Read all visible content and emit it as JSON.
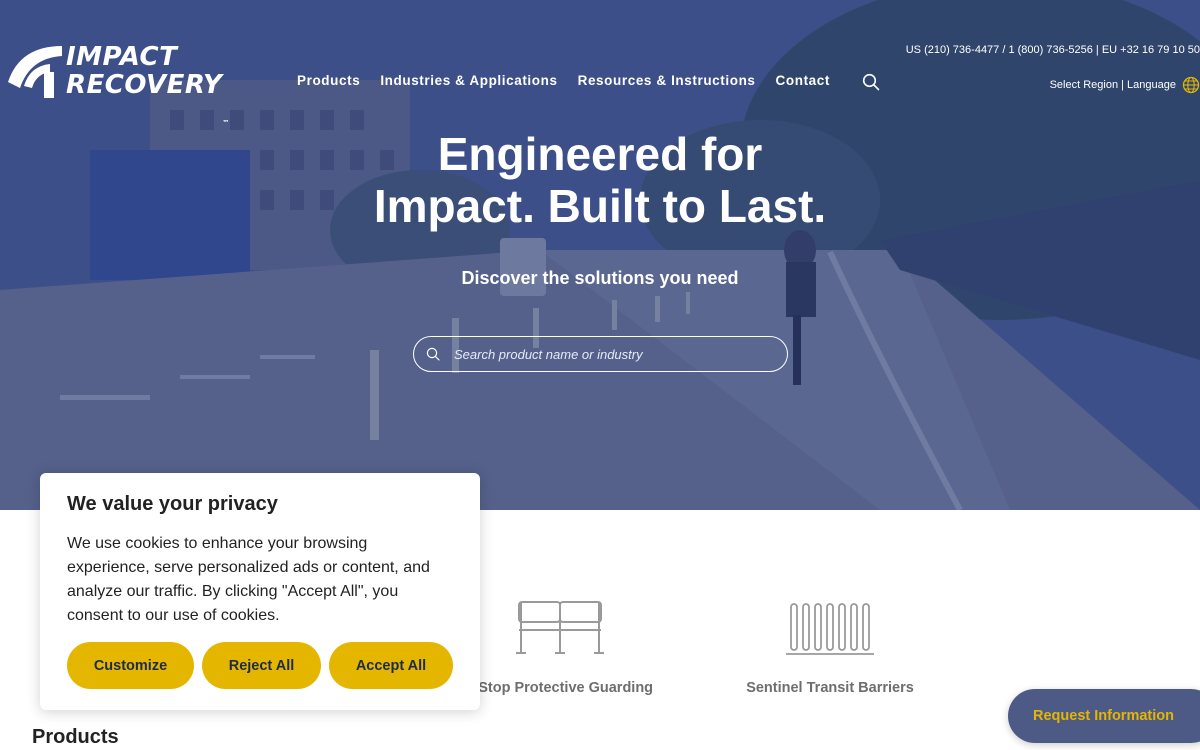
{
  "brand": {
    "line1": "IMPACT",
    "line2": "RECOVERY",
    "tm": "™"
  },
  "nav": {
    "items": [
      {
        "label": "Products"
      },
      {
        "label": "Industries & Applications"
      },
      {
        "label": "Resources & Instructions"
      },
      {
        "label": "Contact"
      }
    ]
  },
  "contact": {
    "phones": "US (210) 736-4477 / 1 (800) 736-5256 | EU +32 16 79 10 50",
    "region_label": "Select Region | Language"
  },
  "hero": {
    "title_line1": "Engineered for",
    "title_line2": "Impact. Built to Last.",
    "subtitle": "Discover the solutions you need",
    "search_placeholder": "Search product name or industry"
  },
  "products": {
    "cards": [
      {
        "label": "wStop Protective Guarding",
        "icon": "guardrail-icon"
      },
      {
        "label": "Sentinel Transit Barriers",
        "icon": "transit-barriers-icon"
      }
    ],
    "heading": "Products"
  },
  "cookie": {
    "title": "We value your privacy",
    "body": "We use cookies to enhance your browsing experience, serve personalized ads or content, and analyze our traffic. By clicking \"Accept All\", you consent to our use of cookies.",
    "customize": "Customize",
    "reject": "Reject All",
    "accept": "Accept All"
  },
  "request_info": "Request Information",
  "colors": {
    "accent": "#e4b600",
    "hero_overlay": "#263876",
    "request_bg": "#4e5a86",
    "button_text": "#1f2b4e"
  }
}
